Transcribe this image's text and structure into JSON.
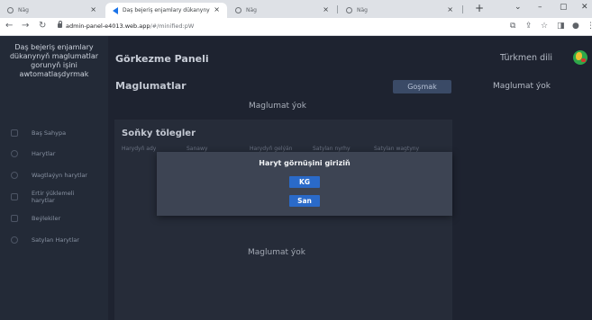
{
  "browser": {
    "tabs": [
      {
        "title": "Näg",
        "active": false
      },
      {
        "title": "Daş bejeriş enjamlary dükanyny",
        "active": true
      },
      {
        "title": "Näg",
        "active": false
      },
      {
        "title": "Näg",
        "active": false
      }
    ],
    "url_host": "admin-panel-e4013.web.app",
    "url_path": "/#/minified:pW"
  },
  "sidebar": {
    "brand": "Daş bejeriş enjamlary dükanynyň maglumatlar gorunyň işini awtomatlaşdyrmak",
    "items": [
      {
        "label": "Baş Sahypa",
        "icon": "home-icon"
      },
      {
        "label": "Harytlar",
        "icon": "box-icon"
      },
      {
        "label": "Wagtlaýyn harytlar",
        "icon": "clock-icon"
      },
      {
        "label": "Ertir ýüklemeli harytlar",
        "icon": "truck-icon"
      },
      {
        "label": "Beýlekiler",
        "icon": "grid-icon"
      },
      {
        "label": "Satylan Harytlar",
        "icon": "cart-icon"
      }
    ]
  },
  "header": {
    "page_title": "Görkezme Paneli",
    "language": "Türkmen dili",
    "language_icon": "turkmenistan-globe-icon"
  },
  "section": {
    "title": "Maglumatlar",
    "add_button": "Goşmak",
    "empty_text": "Maglumat ýok",
    "right_empty_text": "Maglumat ýok"
  },
  "payments": {
    "title": "Soňky tölegler",
    "columns": [
      "Harydyň ady",
      "Sanawy",
      "Harydyň gelýän",
      "Satylan nyrhy",
      "Satylan wagtyny"
    ],
    "empty_text": "Maglumat ýok"
  },
  "modal": {
    "title": "Haryt görnüşini giriziň",
    "options": [
      "KG",
      "San"
    ]
  }
}
